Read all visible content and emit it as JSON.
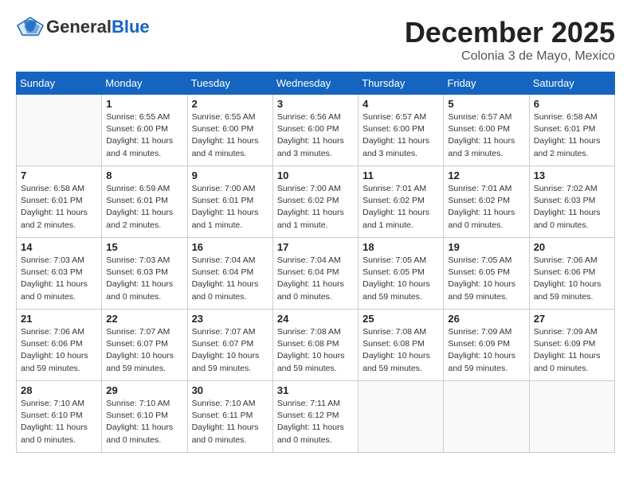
{
  "header": {
    "logo_general": "General",
    "logo_blue": "Blue",
    "month": "December 2025",
    "location": "Colonia 3 de Mayo, Mexico"
  },
  "days_of_week": [
    "Sunday",
    "Monday",
    "Tuesday",
    "Wednesday",
    "Thursday",
    "Friday",
    "Saturday"
  ],
  "weeks": [
    [
      {
        "num": "",
        "sunrise": "",
        "sunset": "",
        "daylight": ""
      },
      {
        "num": "1",
        "sunrise": "Sunrise: 6:55 AM",
        "sunset": "Sunset: 6:00 PM",
        "daylight": "Daylight: 11 hours and 4 minutes."
      },
      {
        "num": "2",
        "sunrise": "Sunrise: 6:55 AM",
        "sunset": "Sunset: 6:00 PM",
        "daylight": "Daylight: 11 hours and 4 minutes."
      },
      {
        "num": "3",
        "sunrise": "Sunrise: 6:56 AM",
        "sunset": "Sunset: 6:00 PM",
        "daylight": "Daylight: 11 hours and 3 minutes."
      },
      {
        "num": "4",
        "sunrise": "Sunrise: 6:57 AM",
        "sunset": "Sunset: 6:00 PM",
        "daylight": "Daylight: 11 hours and 3 minutes."
      },
      {
        "num": "5",
        "sunrise": "Sunrise: 6:57 AM",
        "sunset": "Sunset: 6:00 PM",
        "daylight": "Daylight: 11 hours and 3 minutes."
      },
      {
        "num": "6",
        "sunrise": "Sunrise: 6:58 AM",
        "sunset": "Sunset: 6:01 PM",
        "daylight": "Daylight: 11 hours and 2 minutes."
      }
    ],
    [
      {
        "num": "7",
        "sunrise": "Sunrise: 6:58 AM",
        "sunset": "Sunset: 6:01 PM",
        "daylight": "Daylight: 11 hours and 2 minutes."
      },
      {
        "num": "8",
        "sunrise": "Sunrise: 6:59 AM",
        "sunset": "Sunset: 6:01 PM",
        "daylight": "Daylight: 11 hours and 2 minutes."
      },
      {
        "num": "9",
        "sunrise": "Sunrise: 7:00 AM",
        "sunset": "Sunset: 6:01 PM",
        "daylight": "Daylight: 11 hours and 1 minute."
      },
      {
        "num": "10",
        "sunrise": "Sunrise: 7:00 AM",
        "sunset": "Sunset: 6:02 PM",
        "daylight": "Daylight: 11 hours and 1 minute."
      },
      {
        "num": "11",
        "sunrise": "Sunrise: 7:01 AM",
        "sunset": "Sunset: 6:02 PM",
        "daylight": "Daylight: 11 hours and 1 minute."
      },
      {
        "num": "12",
        "sunrise": "Sunrise: 7:01 AM",
        "sunset": "Sunset: 6:02 PM",
        "daylight": "Daylight: 11 hours and 0 minutes."
      },
      {
        "num": "13",
        "sunrise": "Sunrise: 7:02 AM",
        "sunset": "Sunset: 6:03 PM",
        "daylight": "Daylight: 11 hours and 0 minutes."
      }
    ],
    [
      {
        "num": "14",
        "sunrise": "Sunrise: 7:03 AM",
        "sunset": "Sunset: 6:03 PM",
        "daylight": "Daylight: 11 hours and 0 minutes."
      },
      {
        "num": "15",
        "sunrise": "Sunrise: 7:03 AM",
        "sunset": "Sunset: 6:03 PM",
        "daylight": "Daylight: 11 hours and 0 minutes."
      },
      {
        "num": "16",
        "sunrise": "Sunrise: 7:04 AM",
        "sunset": "Sunset: 6:04 PM",
        "daylight": "Daylight: 11 hours and 0 minutes."
      },
      {
        "num": "17",
        "sunrise": "Sunrise: 7:04 AM",
        "sunset": "Sunset: 6:04 PM",
        "daylight": "Daylight: 11 hours and 0 minutes."
      },
      {
        "num": "18",
        "sunrise": "Sunrise: 7:05 AM",
        "sunset": "Sunset: 6:05 PM",
        "daylight": "Daylight: 10 hours and 59 minutes."
      },
      {
        "num": "19",
        "sunrise": "Sunrise: 7:05 AM",
        "sunset": "Sunset: 6:05 PM",
        "daylight": "Daylight: 10 hours and 59 minutes."
      },
      {
        "num": "20",
        "sunrise": "Sunrise: 7:06 AM",
        "sunset": "Sunset: 6:06 PM",
        "daylight": "Daylight: 10 hours and 59 minutes."
      }
    ],
    [
      {
        "num": "21",
        "sunrise": "Sunrise: 7:06 AM",
        "sunset": "Sunset: 6:06 PM",
        "daylight": "Daylight: 10 hours and 59 minutes."
      },
      {
        "num": "22",
        "sunrise": "Sunrise: 7:07 AM",
        "sunset": "Sunset: 6:07 PM",
        "daylight": "Daylight: 10 hours and 59 minutes."
      },
      {
        "num": "23",
        "sunrise": "Sunrise: 7:07 AM",
        "sunset": "Sunset: 6:07 PM",
        "daylight": "Daylight: 10 hours and 59 minutes."
      },
      {
        "num": "24",
        "sunrise": "Sunrise: 7:08 AM",
        "sunset": "Sunset: 6:08 PM",
        "daylight": "Daylight: 10 hours and 59 minutes."
      },
      {
        "num": "25",
        "sunrise": "Sunrise: 7:08 AM",
        "sunset": "Sunset: 6:08 PM",
        "daylight": "Daylight: 10 hours and 59 minutes."
      },
      {
        "num": "26",
        "sunrise": "Sunrise: 7:09 AM",
        "sunset": "Sunset: 6:09 PM",
        "daylight": "Daylight: 10 hours and 59 minutes."
      },
      {
        "num": "27",
        "sunrise": "Sunrise: 7:09 AM",
        "sunset": "Sunset: 6:09 PM",
        "daylight": "Daylight: 11 hours and 0 minutes."
      }
    ],
    [
      {
        "num": "28",
        "sunrise": "Sunrise: 7:10 AM",
        "sunset": "Sunset: 6:10 PM",
        "daylight": "Daylight: 11 hours and 0 minutes."
      },
      {
        "num": "29",
        "sunrise": "Sunrise: 7:10 AM",
        "sunset": "Sunset: 6:10 PM",
        "daylight": "Daylight: 11 hours and 0 minutes."
      },
      {
        "num": "30",
        "sunrise": "Sunrise: 7:10 AM",
        "sunset": "Sunset: 6:11 PM",
        "daylight": "Daylight: 11 hours and 0 minutes."
      },
      {
        "num": "31",
        "sunrise": "Sunrise: 7:11 AM",
        "sunset": "Sunset: 6:12 PM",
        "daylight": "Daylight: 11 hours and 0 minutes."
      },
      {
        "num": "",
        "sunrise": "",
        "sunset": "",
        "daylight": ""
      },
      {
        "num": "",
        "sunrise": "",
        "sunset": "",
        "daylight": ""
      },
      {
        "num": "",
        "sunrise": "",
        "sunset": "",
        "daylight": ""
      }
    ]
  ]
}
